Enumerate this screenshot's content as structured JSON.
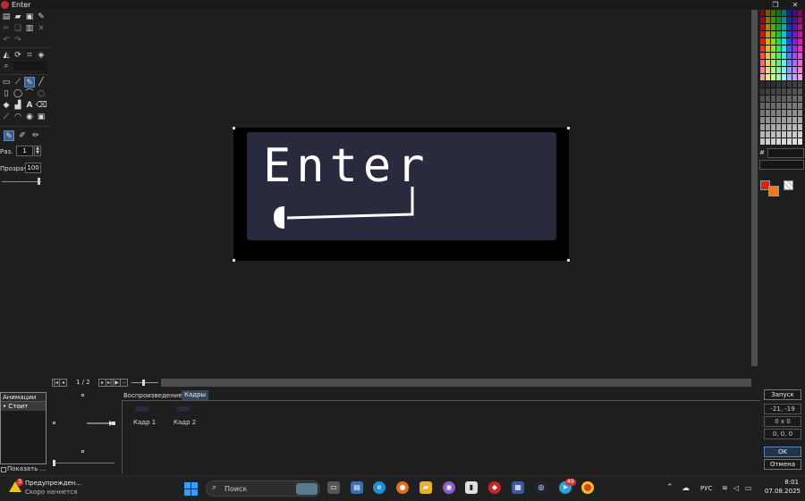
{
  "window": {
    "title": "Enter"
  },
  "canvas": {
    "image_text": "Enter"
  },
  "toolbox": {
    "brush_size_label": "Раз.",
    "brush_size_value": "1",
    "opacity_label": "Прозрач",
    "opacity_value": "100"
  },
  "timeline": {
    "frame_counter": "1 / 2"
  },
  "animations": {
    "header": "Анимации",
    "items": [
      "Стоит"
    ],
    "show_checkbox_label": "Показать ..."
  },
  "frames_panel": {
    "tabs": [
      "Воспроизведение",
      "Кадры"
    ],
    "frames": [
      "Кадр 1",
      "Кадр 2"
    ]
  },
  "right_panel": {
    "run_button": "Запуск",
    "coords": "-21, -19",
    "size": "0 x 0",
    "offset": "0, 0, 0",
    "ok_button": "OK",
    "cancel_button": "Отмена",
    "hex_label": "#"
  },
  "colors": {
    "primary": "#e81b1b",
    "secondary": "#f07a10",
    "panel": "#292a3d",
    "accent": "#3c5f8a"
  },
  "taskbar": {
    "notification_title": "Предупрежден...",
    "notification_subtitle": "Скоро начнется",
    "notification_badge": "3",
    "search_placeholder": "Поиск",
    "language": "РУС",
    "time": "8:01",
    "date": "07.08.2025",
    "chat_badge": "49"
  }
}
